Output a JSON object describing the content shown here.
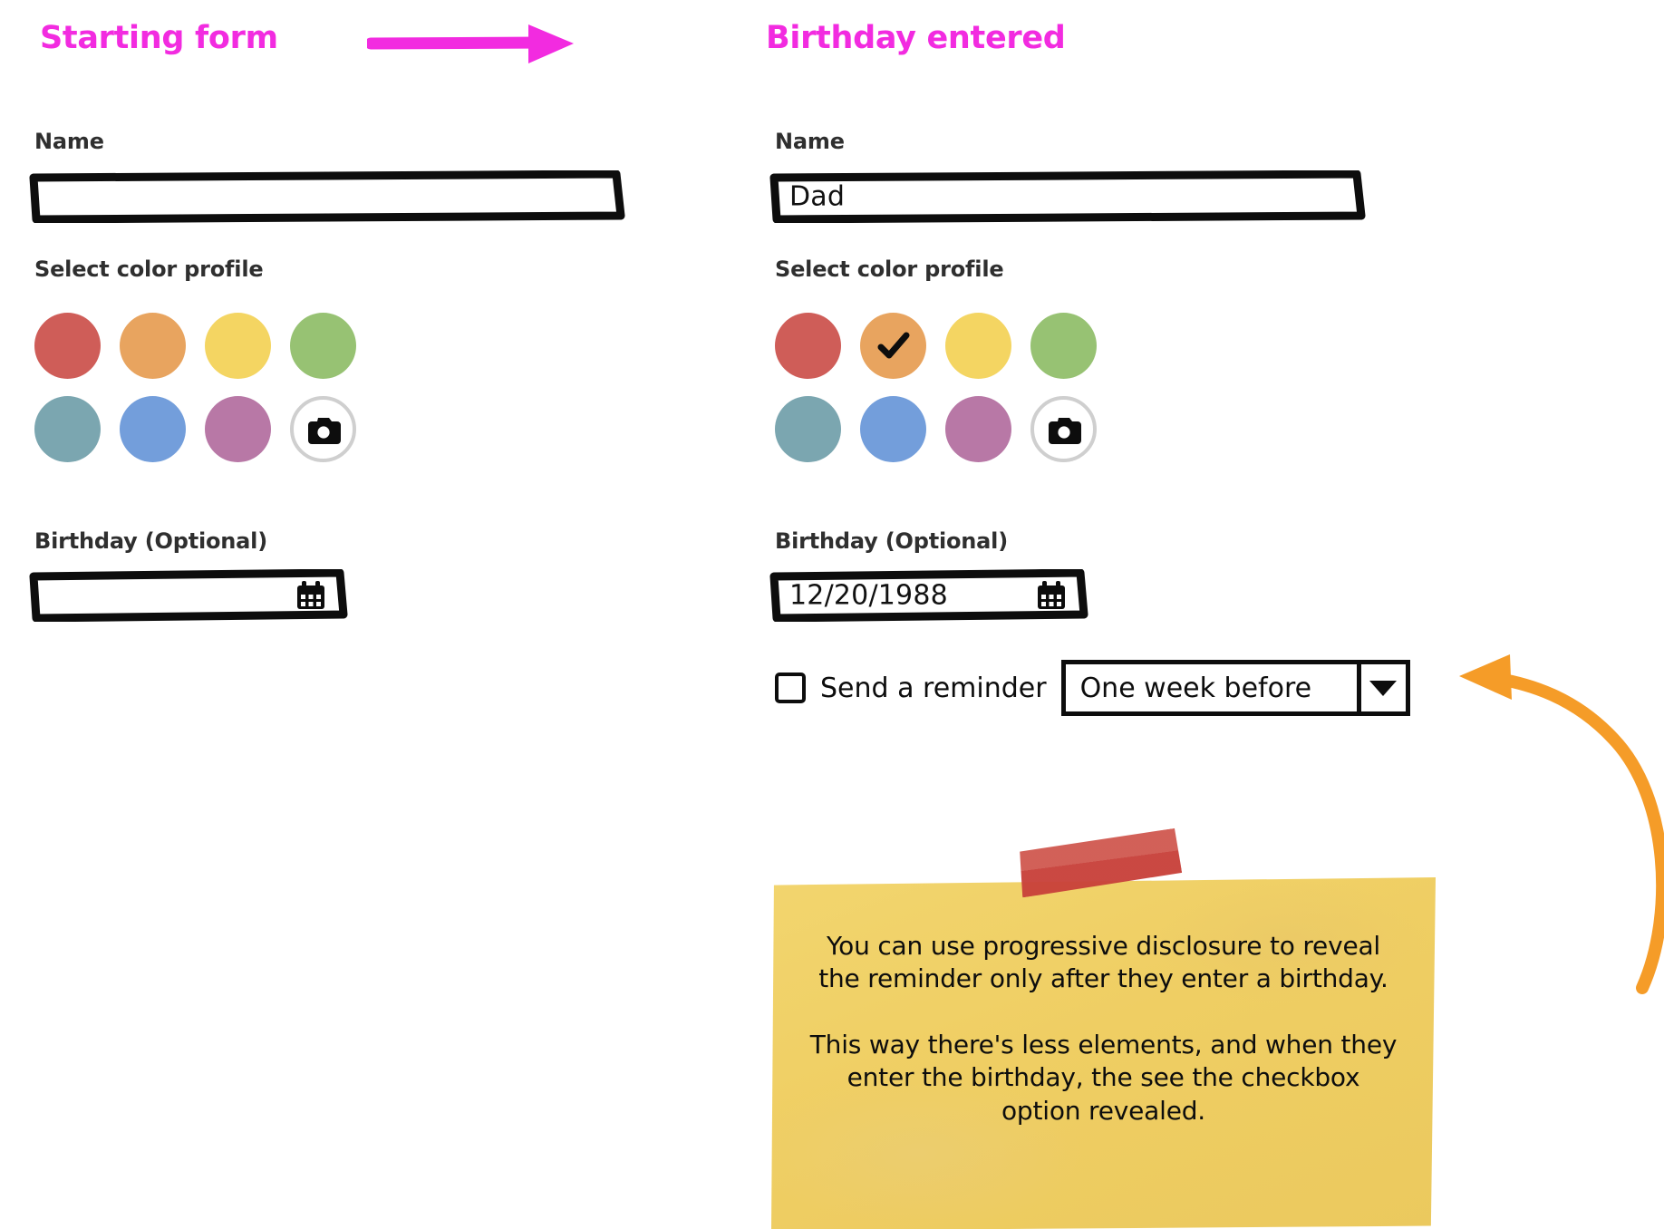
{
  "panels": {
    "left": {
      "title": "Starting form",
      "name_label": "Name",
      "name_value": "",
      "color_label": "Select color profile",
      "birthday_label": "Birthday (Optional)",
      "birthday_value": ""
    },
    "right": {
      "title": "Birthday entered",
      "name_label": "Name",
      "name_value": "Dad",
      "color_label": "Select color profile",
      "birthday_label": "Birthday (Optional)",
      "birthday_value": "12/20/1988",
      "reminder_label": "Send a reminder",
      "reminder_checked": false,
      "reminder_option": "One week before"
    }
  },
  "swatches": {
    "colors": [
      "#CF5D58",
      "#E8A45F",
      "#F4D562",
      "#97C273",
      "#7BA6B0",
      "#739EDB",
      "#B878A6"
    ],
    "camera_icon": "camera-icon",
    "camera_border": "#CFCFCF",
    "selected_index_right": 1,
    "check_icon": "check-icon"
  },
  "icons": {
    "calendar": "calendar-icon",
    "camera": "camera-icon",
    "caret_down": "chevron-down-icon",
    "flow_arrow": "arrow-right-icon",
    "callout_arrow": "curved-arrow-icon"
  },
  "note": {
    "paragraph_1": "You can use progressive disclosure to reveal the reminder only after they enter a birthday.",
    "paragraph_2": "This way there's less elements, and when they enter the birthday, the see the checkbox option revealed.",
    "tape_color": "#C8413A",
    "note_color": "#EFCE63"
  },
  "accent": {
    "title_color": "#F22BE0",
    "callout_arrow_color": "#F59C28"
  }
}
